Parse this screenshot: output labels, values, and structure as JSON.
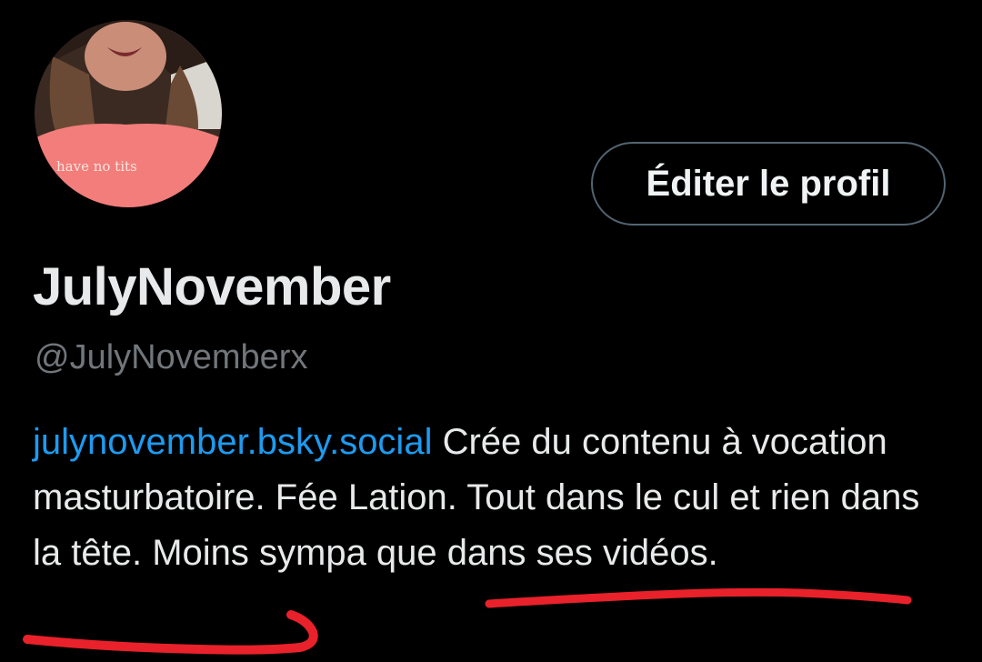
{
  "profile": {
    "avatar_shirt_text": "have no tits",
    "edit_button_label": "Éditer le profil",
    "display_name": "JulyNovember",
    "handle": "@JulyNovemberx",
    "bio_link": "julynovember.bsky.social",
    "bio_text": " Crée du contenu à vocation masturbatoire. Fée Lation. Tout dans le cul et rien dans la tête. Moins sympa que dans ses vidéos."
  },
  "colors": {
    "background": "#000000",
    "text_primary": "#e7e9ea",
    "text_secondary": "#71767b",
    "link": "#1d9bf0",
    "button_border": "#536471",
    "annotation_red": "#e8212a"
  },
  "annotations": [
    "red-underline-moins-sympa",
    "red-underline-ses-videos"
  ]
}
